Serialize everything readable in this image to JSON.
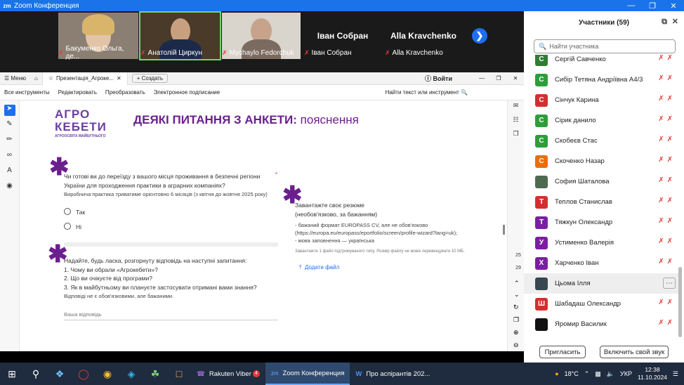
{
  "window": {
    "title": "Zoom Конференция",
    "logo": "zm"
  },
  "videos": [
    {
      "name": "Бакуменко Ольга, де..."
    },
    {
      "name": "Анатолій Циркун"
    },
    {
      "name": "Mychaylo Fedorchuk"
    },
    {
      "name": "Іван Собран",
      "display": "Іван Собран"
    },
    {
      "name": "Alla Kravchenko",
      "display": "Alla Kravchenko"
    }
  ],
  "acrobat": {
    "menu": "Меню",
    "tab": "Презентація_Агроке...",
    "create": "Создать",
    "signin": "Войти",
    "toolbar": [
      "Все инструменты",
      "Редактировать",
      "Преобразовать",
      "Электронное подписание"
    ],
    "find": "Найти текст или инструмент",
    "page_a": "25",
    "page_b": "29"
  },
  "doc": {
    "brand1": "АГРО",
    "brand2": "КЕБЕТИ",
    "brand3": "АГРООСВІТА МАЙБУТНЬОГО",
    "heading": "ДЕЯКІ ПИТАННЯ З АНКЕТИ:",
    "heading_sub": "пояснення",
    "q1_line1": "Чи готові ви до переїзду з вашого місця проживання в безпечні регіони",
    "q1_line2": "України для проходження практики в аграрних компаніях?",
    "q1_note": "Виробнича практика триватиме орієнтовно 6 місяців (з квітня до жовтня 2025 року)",
    "opt_yes": "Так",
    "opt_no": "Ні",
    "q2_line1": "Надайте, будь ласка, розгорнуту відповідь на наступні запитання:",
    "q2_line2": "1. Чому ви обрали «Агрокебети»?",
    "q2_line3": "2. Що ви очікуєте від програми?",
    "q2_line4": "3. Як в майбутньому ви плануєте застосувати отримані вами знання?",
    "q2_note": "Відповіді не є обов'язковими, але бажаними.",
    "answer_placeholder": "Ваша відповідь",
    "q3_line1": "Завантажте своє резюме",
    "q3_line2": "(необов'язково, за бажанням)",
    "q3_line3": "- бажаний формат EUROPASS CV, але не обов'язково",
    "q3_line4": "(https://europa.eu/europass/eportfolio/screen/profile-wizard?lang=uk);",
    "q3_line5": "- мова заповнення — українська",
    "q3_note": "Завантажте 1 файл підтримуваного типу. Розмір файлу не може перевищувати 10 МБ.",
    "upload": "Додати файл"
  },
  "participants": {
    "title": "Участники (59)",
    "search_placeholder": "Найти участника",
    "list": [
      {
        "initial": "С",
        "name": "Сергій Савченко",
        "color": "#2e7d32"
      },
      {
        "initial": "С",
        "name": "Сибір Тетяна Андріївна А4/3",
        "color": "#2e9d3a"
      },
      {
        "initial": "С",
        "name": "Сінчук Карина",
        "color": "#d32f2f"
      },
      {
        "initial": "С",
        "name": "Сірик данило",
        "color": "#2e9d3a"
      },
      {
        "initial": "С",
        "name": "Скобеєв Стас",
        "color": "#2e9d3a"
      },
      {
        "initial": "С",
        "name": "Скоченко Назар",
        "color": "#ef6c00"
      },
      {
        "initial": "",
        "name": "София Шаталова",
        "color": "#4e6a50"
      },
      {
        "initial": "Т",
        "name": "Теплов Станислав",
        "color": "#d32f2f"
      },
      {
        "initial": "Т",
        "name": "Тяжкун Олександр",
        "color": "#7b1fa2"
      },
      {
        "initial": "У",
        "name": "Устименко Валерія",
        "color": "#7b1fa2"
      },
      {
        "initial": "Х",
        "name": "Харченко Іван",
        "color": "#7b1fa2"
      },
      {
        "initial": "",
        "name": "Цьома Ілля",
        "color": "#37474f"
      },
      {
        "initial": "Ш",
        "name": "Шабадаш Олександр",
        "color": "#d32f2f"
      },
      {
        "initial": "",
        "name": "Яромир Василик",
        "color": "#111111"
      }
    ],
    "invite": "Пригласить",
    "unmute": "Включить свой звук"
  },
  "taskbar": {
    "apps": [
      {
        "label": "Rakuten Viber",
        "badge": "4"
      },
      {
        "label": "Zoom Конференция"
      },
      {
        "label": "Про аспірантів 202..."
      }
    ],
    "temp": "18°C",
    "lang": "УКР",
    "time": "12:38",
    "date": "11.10.2024"
  }
}
